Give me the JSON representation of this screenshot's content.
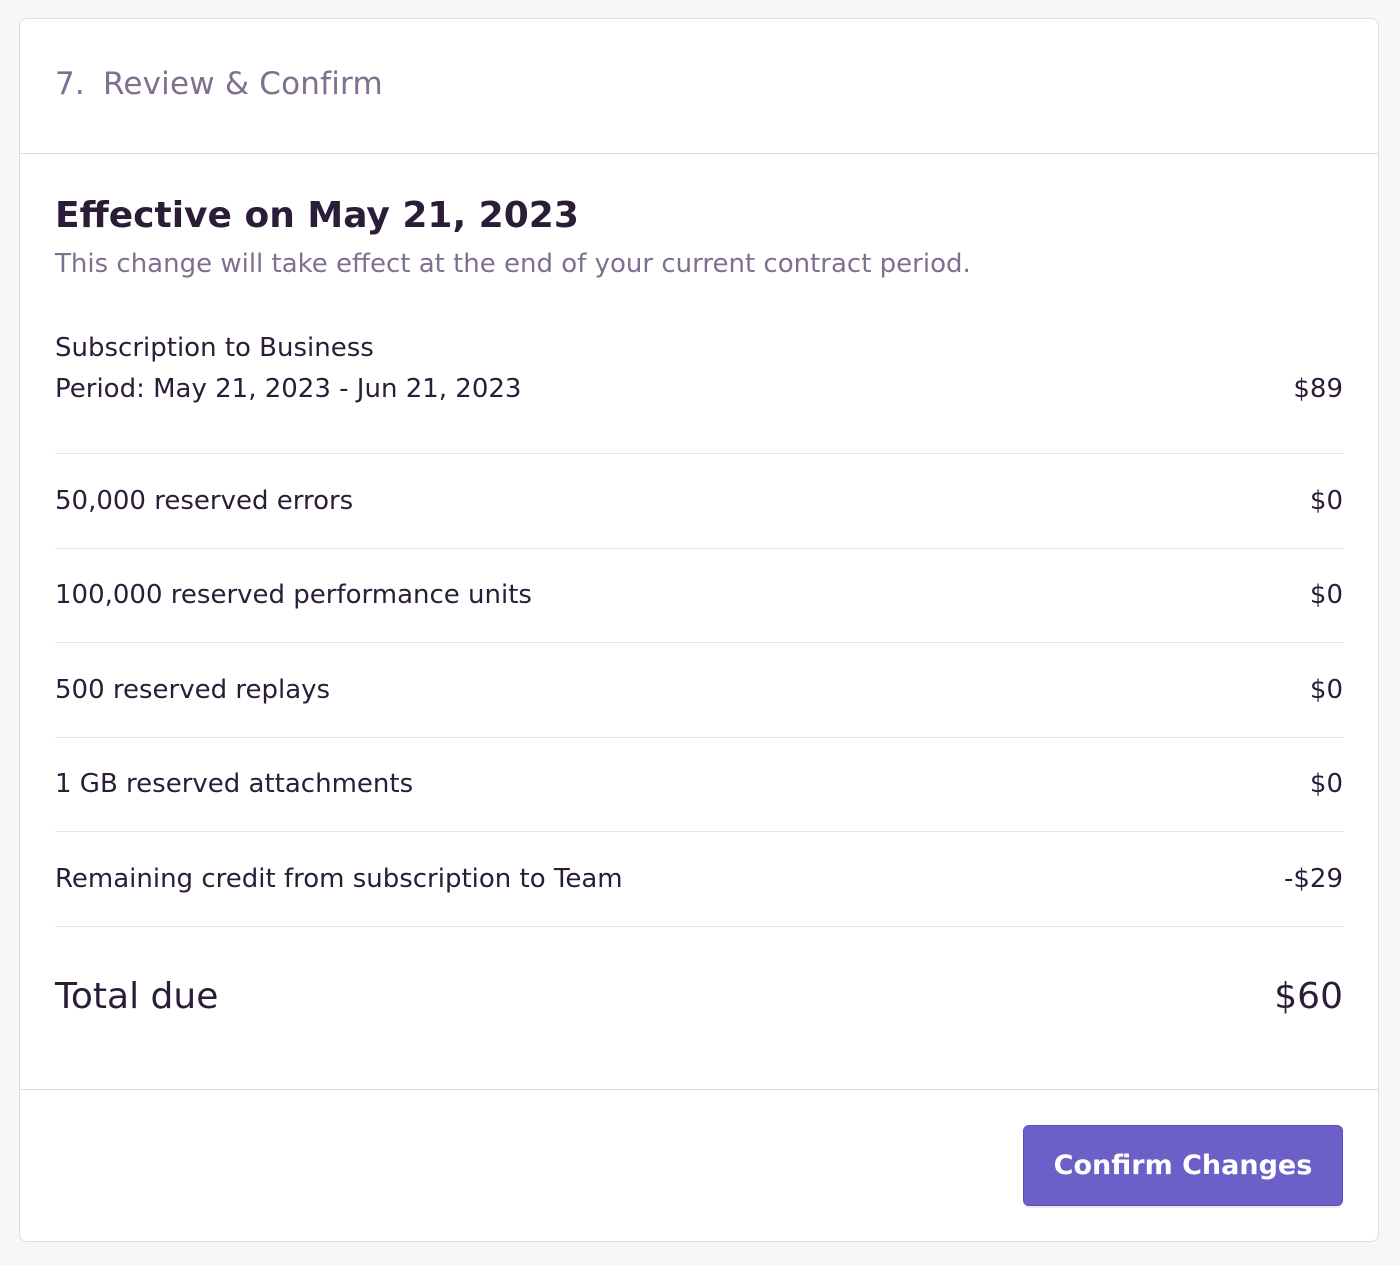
{
  "step": {
    "number": "7.",
    "title": "Review & Confirm"
  },
  "effective": {
    "title": "Effective on May 21, 2023",
    "description": "This change will take effect at the end of your current contract period."
  },
  "plan": {
    "name": "Subscription to Business"
  },
  "line_items": [
    {
      "label": "Period: May 21, 2023 - Jun 21, 2023",
      "amount": "$89"
    },
    {
      "label": "50,000 reserved errors",
      "amount": "$0"
    },
    {
      "label": "100,000 reserved performance units",
      "amount": "$0"
    },
    {
      "label": "500 reserved replays",
      "amount": "$0"
    },
    {
      "label": "1 GB reserved attachments",
      "amount": "$0"
    },
    {
      "label": "Remaining credit from subscription to Team",
      "amount": "-$29"
    }
  ],
  "total": {
    "label": "Total due",
    "amount": "$60"
  },
  "footer": {
    "confirm_label": "Confirm Changes"
  },
  "colors": {
    "accent": "#6c5fc7",
    "muted_text": "#80708f",
    "primary_text": "#2b1d38",
    "border": "#e0dce5",
    "page_background": "#f7f7fa"
  }
}
